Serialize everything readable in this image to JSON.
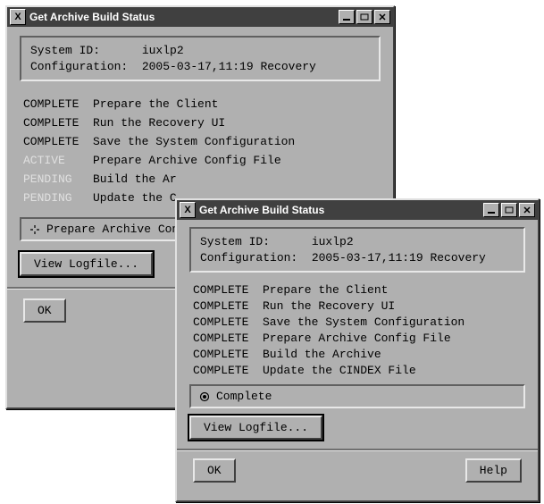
{
  "windowBack": {
    "title": "Get Archive Build Status",
    "info": {
      "sysid_label": "System ID:",
      "sysid_value": "iuxlp2",
      "config_label": "Configuration:",
      "config_value": "2005-03-17,11:19 Recovery"
    },
    "steps": [
      {
        "status": "COMPLETE",
        "desc": "Prepare the Client",
        "faded": false
      },
      {
        "status": "COMPLETE",
        "desc": "Run the Recovery UI",
        "faded": false
      },
      {
        "status": "COMPLETE",
        "desc": "Save the System Configuration",
        "faded": false
      },
      {
        "status": "ACTIVE",
        "desc": "Prepare Archive Config File",
        "faded": true
      },
      {
        "status": "PENDING",
        "desc": "Build the Ar",
        "faded": true
      },
      {
        "status": "PENDING",
        "desc": "Update the C",
        "faded": true
      }
    ],
    "progress_label": "Prepare Archive Conf",
    "view_logfile_label": "View Logfile...",
    "ok_label": "OK"
  },
  "windowFront": {
    "title": "Get Archive Build Status",
    "info": {
      "sysid_label": "System ID:",
      "sysid_value": "iuxlp2",
      "config_label": "Configuration:",
      "config_value": "2005-03-17,11:19 Recovery"
    },
    "steps": [
      {
        "status": "COMPLETE",
        "desc": "Prepare the Client"
      },
      {
        "status": "COMPLETE",
        "desc": "Run the Recovery UI"
      },
      {
        "status": "COMPLETE",
        "desc": "Save the System Configuration"
      },
      {
        "status": "COMPLETE",
        "desc": "Prepare Archive Config File"
      },
      {
        "status": "COMPLETE",
        "desc": "Build the Archive"
      },
      {
        "status": "COMPLETE",
        "desc": "Update the CINDEX File"
      }
    ],
    "progress_label": "Complete",
    "view_logfile_label": "View Logfile...",
    "ok_label": "OK",
    "help_label": "Help"
  }
}
